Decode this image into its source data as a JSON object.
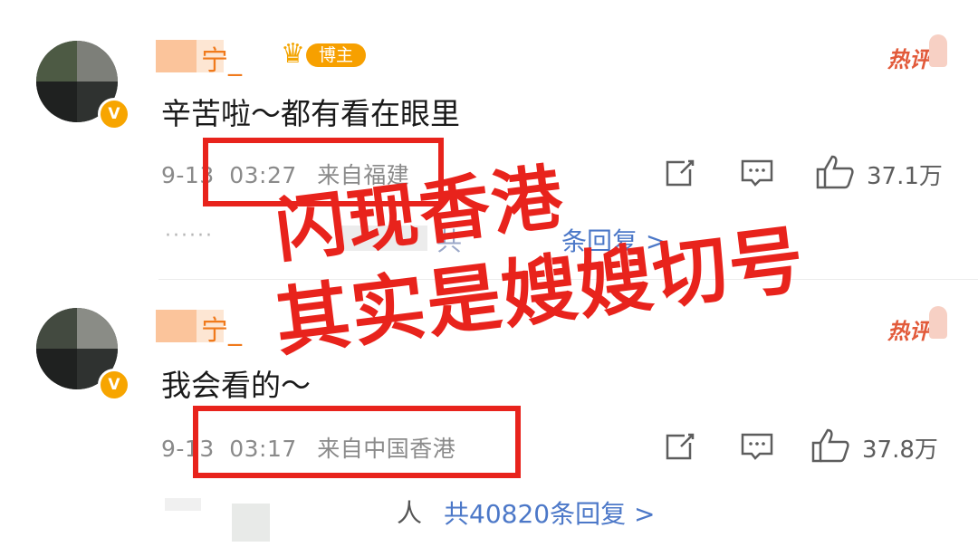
{
  "comments": [
    {
      "username": "宁_",
      "badge_label": "博主",
      "hot_label": "热评",
      "text": "辛苦啦～都有看在眼里",
      "date": "9-13",
      "time": "03:27",
      "location": "来自福建",
      "likes": "37.1万",
      "replies_text": "共",
      "replies_suffix": "条回复 >"
    },
    {
      "username": "宁_",
      "hot_label": "热评",
      "text": "我会看的～",
      "date": "9-13",
      "time": "03:17",
      "location": "来自中国香港",
      "likes": "37.8万",
      "replies_prefix": "人",
      "replies_text": "共40820条回复 >"
    }
  ],
  "overlay": {
    "line1": "闪现香港",
    "line2": "其实是嫂嫂切号"
  },
  "colors": {
    "annotation_red": "#e8231c",
    "link_blue": "#4c78c8",
    "badge_orange": "#f7a000",
    "username_orange": "#f07a1c"
  }
}
